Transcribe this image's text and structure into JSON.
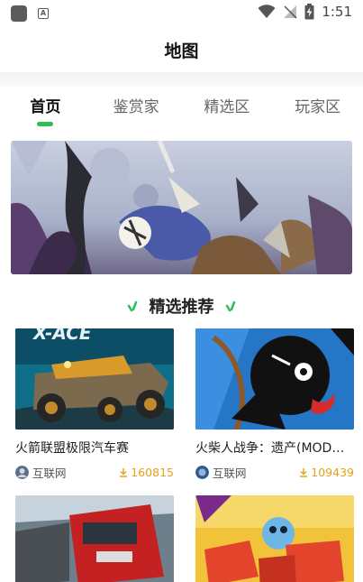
{
  "status_bar": {
    "time": "1:51"
  },
  "header": {
    "title": "地图"
  },
  "tabs": [
    {
      "label": "首页",
      "active": true
    },
    {
      "label": "鉴赏家",
      "active": false
    },
    {
      "label": "精选区",
      "active": false
    },
    {
      "label": "玩家区",
      "active": false
    }
  ],
  "section": {
    "title": "精选推荐"
  },
  "games": [
    {
      "title": "火箭联盟极限汽车赛",
      "source": "互联网",
      "downloads": "160815",
      "icon": "download-icon"
    },
    {
      "title": "火柴人战争：遗产(MOD…",
      "source": "互联网",
      "downloads": "109439",
      "icon": "download-icon"
    },
    {
      "title": "",
      "source": "",
      "downloads": ""
    },
    {
      "title": "",
      "source": "",
      "downloads": ""
    }
  ],
  "colors": {
    "accent": "#2ebd59",
    "downloads": "#e4a11b"
  }
}
